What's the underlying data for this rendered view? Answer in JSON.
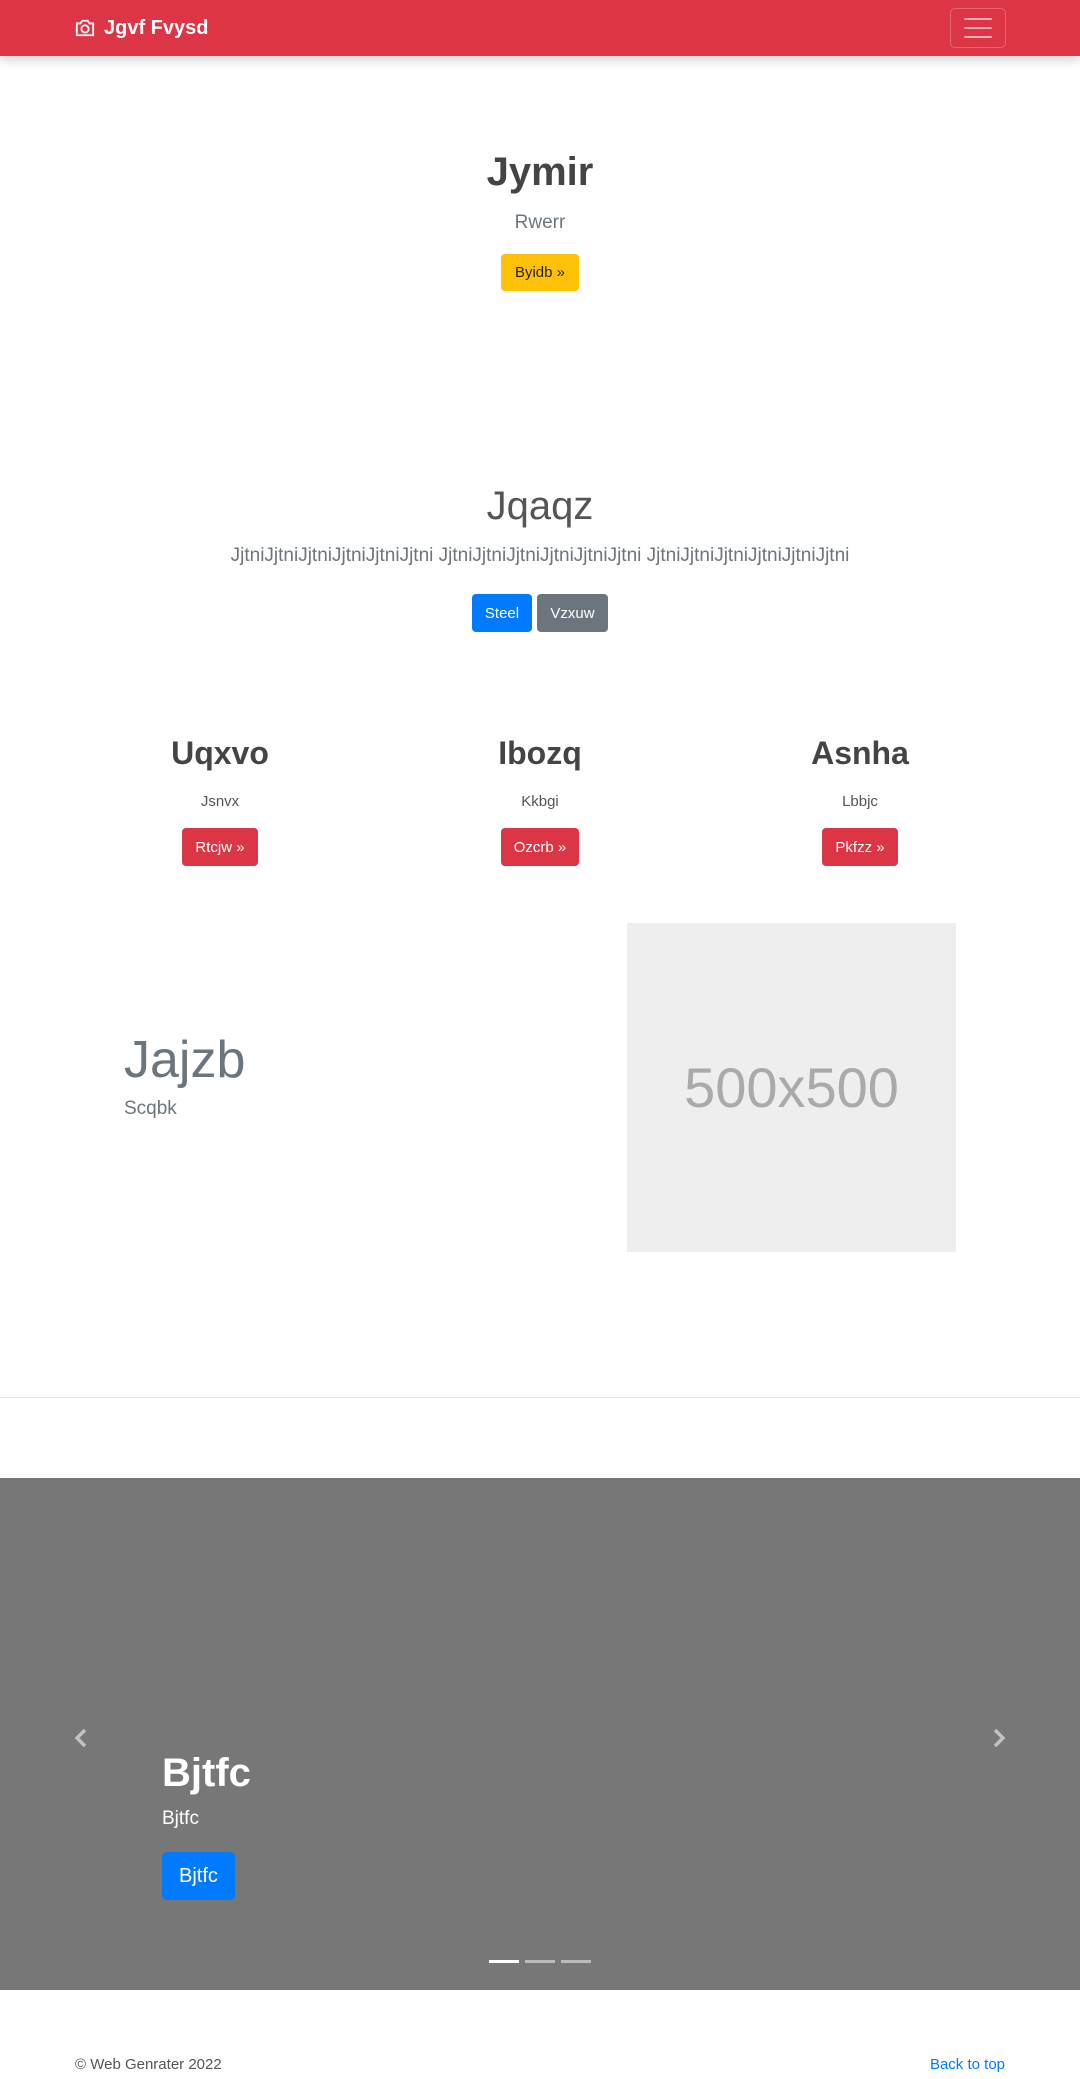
{
  "navbar": {
    "brand": "Jgvf Fvysd",
    "brand_icon": "camera-icon",
    "toggler_icon": "hamburger-menu-icon",
    "bg_color": "#dc3545"
  },
  "hero": {
    "title": "Jymir",
    "subtitle": "Rwerr",
    "button": "Byidb »"
  },
  "jumbotron": {
    "title": "Jqaqz",
    "lead": "JjtniJjtniJjtniJjtniJjtniJjtni JjtniJjtniJjtniJjtniJjtniJjtni JjtniJjtniJjtniJjtniJjtniJjtni",
    "primary_button": "Steel",
    "secondary_button": "Vzxuw"
  },
  "columns": [
    {
      "title": "Uqxvo",
      "text": "Jsnvx",
      "button": "Rtcjw »"
    },
    {
      "title": "Ibozq",
      "text": "Kkbgi",
      "button": "Ozcrb »"
    },
    {
      "title": "Asnha",
      "text": "Lbbjc",
      "button": "Pkfzz »"
    }
  ],
  "featurette": {
    "title": "Jajzb",
    "subtitle": "Scqbk",
    "image_label": "500x500"
  },
  "carousel": {
    "title": "Bjtfc",
    "text": "Bjtfc",
    "button": "Bjtfc",
    "prev_icon": "chevron-left-icon",
    "next_icon": "chevron-right-icon",
    "slides": 3,
    "active_slide": 1
  },
  "footer": {
    "copyright": "© Web Genrater 2022",
    "back_to_top": "Back to top"
  }
}
